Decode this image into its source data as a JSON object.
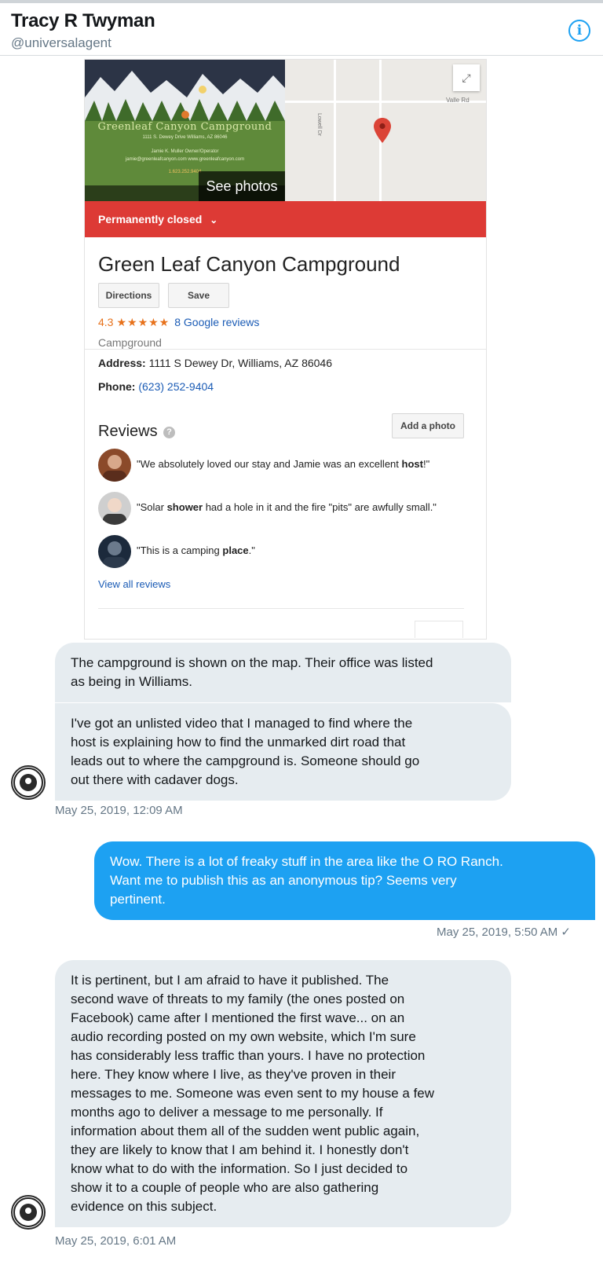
{
  "header": {
    "name": "Tracy R Twyman",
    "handle": "@universalagent",
    "info_icon": "info-icon"
  },
  "place_card": {
    "photo": {
      "campground_sign": "Greenleaf Canyon Campground",
      "sign_address": "1111 S. Dewey Drive   Williams, AZ 86046",
      "sign_owner": "Jamie K. Muller   Owner/Operator",
      "sign_web": "jamie@greenleafcanyon.com   www.greenleafcanyon.com",
      "sign_phone": "1.623.252.9404",
      "see_photos": "See photos"
    },
    "map": {
      "road_vertical": "Lowell Dr",
      "road_horizontal": "Valle Rd",
      "expand_icon": "expand-icon",
      "pin_icon": "map-pin-icon"
    },
    "status": "Permanently closed",
    "status_chevron": "⌄",
    "name": "Green Leaf Canyon Campground",
    "directions_label": "Directions",
    "save_label": "Save",
    "rating": "4.3",
    "stars": "★★★★★",
    "reviews_link": "8 Google reviews",
    "category": "Campground",
    "address_label": "Address:",
    "address": "1111 S Dewey Dr, Williams, AZ 86046",
    "phone_label": "Phone:",
    "phone": "(623) 252-9404",
    "reviews_heading": "Reviews",
    "help_icon": "?",
    "add_photo_label": "Add a photo",
    "reviews": [
      {
        "pre": "\"We absolutely loved our stay and Jamie was an excellent ",
        "bold": "host",
        "post": "!\""
      },
      {
        "pre": "\"Solar ",
        "bold": "shower",
        "post": " had a hole in it and the fire \"pits\" are awfully small.\""
      },
      {
        "pre": "\"This is a camping ",
        "bold": "place",
        "post": ".\""
      }
    ],
    "view_all_reviews": "View all reviews"
  },
  "messages": [
    {
      "lines": [
        "The campground is shown on the map. Their office was listed",
        "as being in Williams."
      ]
    },
    {
      "lines": [
        "I've got an unlisted video that I managed to find where the",
        "host is explaining how to find the unmarked dirt road that",
        "leads out to where the campground is. Someone should go",
        "out there with cadaver dogs."
      ]
    },
    {
      "lines": [
        "Wow. There is a lot of freaky stuff in the area like the O RO Ranch.",
        "Want me to publish this as an anonymous tip? Seems very",
        "pertinent."
      ]
    },
    {
      "lines": [
        "It is pertinent, but I am afraid to have it published. The",
        "second wave of threats to my family (the ones posted on",
        "Facebook) came after I mentioned the first wave... on an",
        "audio recording posted on my own website, which I'm sure",
        "has considerably less traffic than yours. I have no protection",
        "here. They know where I live, as they've proven in their",
        "messages to me. Someone was even sent to my house a few",
        "months ago to deliver a message to me personally. If",
        "information about them all of the sudden went public again,",
        "they are likely to know that I am behind it. I honestly don't",
        "know what to do with the information. So I just decided to",
        "show it to a couple of people who are also gathering",
        "evidence on this subject."
      ]
    }
  ],
  "timestamps": {
    "t1": "May 25, 2019, 12:09 AM",
    "t2": "May 25, 2019, 5:50 AM ✓",
    "t3": "May 25, 2019, 6:01 AM"
  },
  "colors": {
    "accent": "#1da1f2",
    "incoming_bubble": "#e6ecf0",
    "closed_red": "#dd3a35",
    "star_orange": "#e7711b",
    "link_blue": "#1a5bb5"
  }
}
